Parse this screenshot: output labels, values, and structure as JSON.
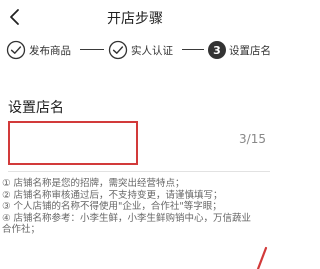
{
  "header": {
    "title": "开店步骤",
    "back_icon": "chevron-left-icon"
  },
  "steps": [
    {
      "label": "发布商品",
      "status": "done",
      "icon": "check-circle-icon"
    },
    {
      "label": "实人认证",
      "status": "done",
      "icon": "check-circle-icon"
    },
    {
      "label": "设置店名",
      "status": "current",
      "number": "3"
    }
  ],
  "shop_name": {
    "label": "设置店名",
    "value": "",
    "char_count": "3/15"
  },
  "rules": [
    "① 店铺名称是您的招牌，需突出经营特点；",
    "② 店铺名称审核通过后，不支持变更，请谨慎填写；",
    "③ 个人店铺的名称不得使用\"企业，合作社\"等字眼；",
    "④ 店铺名称参考：小李生鲜，小李生鲜购销中心，万信蔬业",
    "合作社；"
  ],
  "colors": {
    "accent_red": "#d23a3a",
    "step_dark": "#333333",
    "hint_gray": "#666666"
  }
}
